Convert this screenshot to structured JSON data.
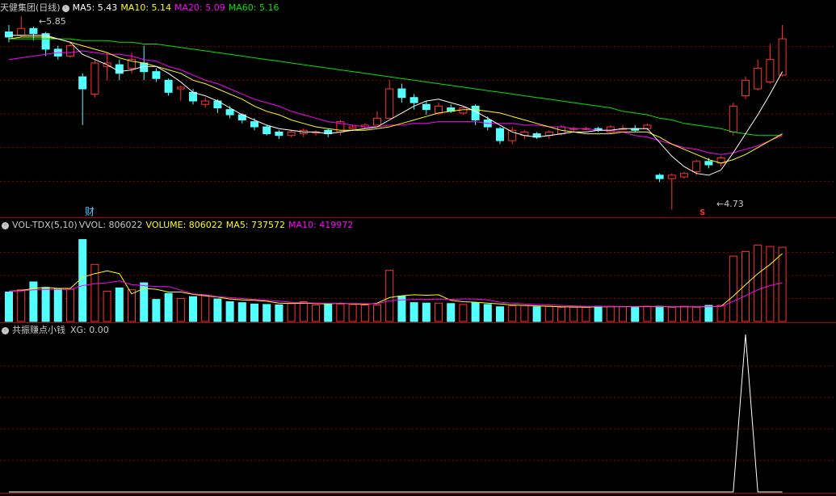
{
  "main": {
    "title": "天健集团(日线)",
    "ma5_label": "MA5: 5.43",
    "ma10_label": "MA10: 5.14",
    "ma20_label": "MA20: 5.09",
    "ma60_label": "MA60: 5.16",
    "high_label": "5.85",
    "low_label": "4.73",
    "cai_marker": "财",
    "s_marker": "S"
  },
  "vol": {
    "title": "VOL-TDX(5,10)",
    "vvol_label": "VVOL: 806022",
    "volume_label": "VOLUME: 806022",
    "ma5_label": "MA5: 737572",
    "ma10_label": "MA10: 419972"
  },
  "ind": {
    "title": "共振赚点小钱",
    "xg_label": "XG: 0.00"
  },
  "colors": {
    "up": "#ff3232",
    "down": "#54ffff",
    "ma5": "#ffffff",
    "ma10": "#ffff00",
    "ma20": "#ff00ff",
    "ma60": "#00e600",
    "grid": "#8a0000",
    "border": "#b40000"
  },
  "chart_data": {
    "type": "candlestick",
    "ohlc": [
      [
        5.76,
        5.73,
        5.8,
        5.7
      ],
      [
        5.74,
        5.78,
        5.85,
        5.73
      ],
      [
        5.78,
        5.75,
        5.79,
        5.71
      ],
      [
        5.75,
        5.66,
        5.76,
        5.62
      ],
      [
        5.66,
        5.62,
        5.68,
        5.6
      ],
      [
        5.62,
        5.68,
        5.7,
        5.61
      ],
      [
        5.5,
        5.43,
        5.52,
        5.22
      ],
      [
        5.4,
        5.58,
        5.6,
        5.38
      ],
      [
        5.56,
        5.58,
        5.64,
        5.48
      ],
      [
        5.57,
        5.52,
        5.6,
        5.48
      ],
      [
        5.55,
        5.6,
        5.64,
        5.52
      ],
      [
        5.58,
        5.53,
        5.68,
        5.48
      ],
      [
        5.53,
        5.49,
        5.55,
        5.47
      ],
      [
        5.48,
        5.41,
        5.49,
        5.39
      ],
      [
        5.43,
        5.44,
        5.45,
        5.36
      ],
      [
        5.41,
        5.36,
        5.43,
        5.34
      ],
      [
        5.34,
        5.36,
        5.38,
        5.32
      ],
      [
        5.36,
        5.32,
        5.37,
        5.29
      ],
      [
        5.31,
        5.28,
        5.33,
        5.26
      ],
      [
        5.28,
        5.25,
        5.29,
        5.23
      ],
      [
        5.24,
        5.21,
        5.26,
        5.19
      ],
      [
        5.21,
        5.17,
        5.22,
        5.16
      ],
      [
        5.18,
        5.16,
        5.19,
        5.14
      ],
      [
        5.16,
        5.18,
        5.19,
        5.15
      ],
      [
        5.17,
        5.19,
        5.2,
        5.15
      ],
      [
        5.18,
        5.18,
        5.19,
        5.16
      ],
      [
        5.19,
        5.17,
        5.2,
        5.15
      ],
      [
        5.18,
        5.24,
        5.25,
        5.16
      ],
      [
        5.2,
        5.21,
        5.22,
        5.19
      ],
      [
        5.21,
        5.22,
        5.23,
        5.2
      ],
      [
        5.22,
        5.26,
        5.3,
        5.22
      ],
      [
        5.26,
        5.43,
        5.48,
        5.26
      ],
      [
        5.43,
        5.38,
        5.46,
        5.35
      ],
      [
        5.38,
        5.35,
        5.4,
        5.31
      ],
      [
        5.34,
        5.31,
        5.36,
        5.28
      ],
      [
        5.29,
        5.33,
        5.35,
        5.28
      ],
      [
        5.32,
        5.3,
        5.34,
        5.29
      ],
      [
        5.29,
        5.32,
        5.33,
        5.28
      ],
      [
        5.33,
        5.25,
        5.34,
        5.22
      ],
      [
        5.25,
        5.21,
        5.27,
        5.19
      ],
      [
        5.2,
        5.13,
        5.21,
        5.11
      ],
      [
        5.13,
        5.19,
        5.21,
        5.11
      ],
      [
        5.16,
        5.18,
        5.19,
        5.14
      ],
      [
        5.17,
        5.15,
        5.18,
        5.14
      ],
      [
        5.16,
        5.18,
        5.19,
        5.14
      ],
      [
        5.17,
        5.21,
        5.22,
        5.16
      ],
      [
        5.2,
        5.2,
        5.21,
        5.18
      ],
      [
        5.2,
        5.2,
        5.21,
        5.19
      ],
      [
        5.2,
        5.19,
        5.21,
        5.18
      ],
      [
        5.18,
        5.21,
        5.22,
        5.17
      ],
      [
        5.2,
        5.2,
        5.22,
        5.19
      ],
      [
        5.2,
        5.19,
        5.22,
        5.18
      ],
      [
        5.2,
        5.22,
        5.23,
        5.19
      ],
      [
        4.93,
        4.91,
        4.94,
        4.89
      ],
      [
        4.91,
        4.93,
        4.94,
        4.73
      ],
      [
        4.92,
        4.94,
        4.95,
        4.91
      ],
      [
        4.95,
        5.01,
        5.02,
        4.93
      ],
      [
        5.01,
        4.99,
        5.03,
        4.97
      ],
      [
        5.0,
        5.03,
        5.04,
        4.98
      ],
      [
        5.18,
        5.33,
        5.35,
        5.16
      ],
      [
        5.39,
        5.48,
        5.5,
        5.37
      ],
      [
        5.43,
        5.55,
        5.6,
        5.42
      ],
      [
        5.47,
        5.6,
        5.69,
        5.46
      ],
      [
        5.51,
        5.72,
        5.8,
        5.5
      ]
    ],
    "ma5": [
      5.74,
      5.74,
      5.74,
      5.74,
      5.72,
      5.7,
      5.63,
      5.6,
      5.57,
      5.53,
      5.54,
      5.56,
      5.56,
      5.52,
      5.47,
      5.41,
      5.39,
      5.36,
      5.32,
      5.28,
      5.25,
      5.22,
      5.2,
      5.19,
      5.18,
      5.18,
      5.17,
      5.18,
      5.19,
      5.2,
      5.21,
      5.25,
      5.29,
      5.33,
      5.36,
      5.37,
      5.35,
      5.33,
      5.3,
      5.26,
      5.22,
      5.18,
      5.16,
      5.15,
      5.16,
      5.17,
      5.18,
      5.18,
      5.19,
      5.19,
      5.2,
      5.2,
      5.2,
      5.12,
      5.04,
      4.98,
      4.94,
      4.93,
      4.96,
      5.06,
      5.17,
      5.28,
      5.4,
      5.53
    ],
    "ma10": [
      5.72,
      5.73,
      5.73,
      5.73,
      5.72,
      5.7,
      5.68,
      5.66,
      5.64,
      5.61,
      5.59,
      5.58,
      5.56,
      5.54,
      5.52,
      5.48,
      5.46,
      5.43,
      5.4,
      5.37,
      5.33,
      5.3,
      5.28,
      5.25,
      5.23,
      5.21,
      5.2,
      5.19,
      5.19,
      5.19,
      5.2,
      5.21,
      5.23,
      5.25,
      5.27,
      5.29,
      5.3,
      5.31,
      5.31,
      5.3,
      5.29,
      5.27,
      5.25,
      5.23,
      5.21,
      5.19,
      5.18,
      5.17,
      5.17,
      5.17,
      5.18,
      5.18,
      5.18,
      5.15,
      5.11,
      5.08,
      5.05,
      5.02,
      5.0,
      5.02,
      5.05,
      5.09,
      5.13,
      5.17
    ],
    "ma20": [
      5.6,
      5.61,
      5.62,
      5.63,
      5.64,
      5.64,
      5.65,
      5.64,
      5.63,
      5.63,
      5.62,
      5.6,
      5.59,
      5.56,
      5.54,
      5.51,
      5.48,
      5.46,
      5.43,
      5.4,
      5.37,
      5.35,
      5.33,
      5.3,
      5.28,
      5.26,
      5.24,
      5.23,
      5.22,
      5.21,
      5.21,
      5.22,
      5.22,
      5.23,
      5.23,
      5.24,
      5.24,
      5.24,
      5.24,
      5.23,
      5.23,
      5.23,
      5.22,
      5.22,
      5.21,
      5.21,
      5.2,
      5.2,
      5.19,
      5.19,
      5.18,
      5.16,
      5.15,
      5.13,
      5.11,
      5.09,
      5.08,
      5.06,
      5.05,
      5.06,
      5.08,
      5.1,
      5.13,
      5.16
    ],
    "ma60": [
      5.72,
      5.72,
      5.72,
      5.72,
      5.72,
      5.72,
      5.71,
      5.71,
      5.71,
      5.7,
      5.7,
      5.69,
      5.69,
      5.68,
      5.67,
      5.66,
      5.65,
      5.64,
      5.63,
      5.62,
      5.61,
      5.6,
      5.59,
      5.58,
      5.57,
      5.56,
      5.55,
      5.54,
      5.53,
      5.52,
      5.51,
      5.5,
      5.49,
      5.48,
      5.47,
      5.46,
      5.45,
      5.44,
      5.43,
      5.42,
      5.41,
      5.4,
      5.39,
      5.38,
      5.37,
      5.36,
      5.35,
      5.34,
      5.33,
      5.32,
      5.3,
      5.29,
      5.28,
      5.26,
      5.25,
      5.23,
      5.22,
      5.21,
      5.2,
      5.18,
      5.17,
      5.16,
      5.16,
      5.16
    ],
    "volume": [
      320000,
      345000,
      430000,
      370000,
      355000,
      350000,
      890000,
      620000,
      330000,
      365000,
      345000,
      420000,
      240000,
      305000,
      250000,
      270000,
      280000,
      245000,
      215000,
      205000,
      190000,
      185000,
      180000,
      200000,
      215000,
      180000,
      185000,
      190000,
      185000,
      180000,
      180000,
      555000,
      275000,
      205000,
      200000,
      200000,
      195000,
      185000,
      205000,
      185000,
      160000,
      170000,
      175000,
      160000,
      165000,
      155000,
      155000,
      155000,
      165000,
      165000,
      160000,
      160000,
      165000,
      165000,
      155000,
      165000,
      155000,
      175000,
      175000,
      710000,
      760000,
      830000,
      815000,
      806022
    ],
    "vol_ma5": [
      330000,
      335000,
      360000,
      370000,
      360000,
      360000,
      480000,
      520000,
      550000,
      520000,
      300000,
      360000,
      350000,
      320000,
      320000,
      295000,
      280000,
      265000,
      245000,
      235000,
      230000,
      220000,
      200000,
      195000,
      200000,
      195000,
      190000,
      200000,
      190000,
      185000,
      200000,
      260000,
      280000,
      290000,
      285000,
      290000,
      230000,
      215000,
      210000,
      200000,
      190000,
      180000,
      175000,
      170000,
      165000,
      160000,
      158000,
      156000,
      160000,
      160000,
      162000,
      162000,
      163000,
      163000,
      160000,
      160000,
      160000,
      160000,
      165000,
      275000,
      400000,
      520000,
      620000,
      737572
    ],
    "vol_ma10": [
      330000,
      332000,
      345000,
      350000,
      348000,
      350000,
      390000,
      410000,
      420000,
      440000,
      400000,
      390000,
      380000,
      380000,
      340000,
      300000,
      290000,
      270000,
      260000,
      250000,
      240000,
      230000,
      220000,
      210000,
      205000,
      200000,
      197000,
      195000,
      195000,
      193000,
      193000,
      225000,
      235000,
      240000,
      240000,
      245000,
      240000,
      245000,
      245000,
      235000,
      210000,
      200000,
      190000,
      185000,
      180000,
      175000,
      170000,
      165000,
      163000,
      162000,
      160000,
      160000,
      160000,
      160000,
      160000,
      160000,
      160000,
      160000,
      162000,
      218000,
      280000,
      345000,
      390000,
      419972
    ],
    "xg": [
      0,
      0,
      0,
      0,
      0,
      0,
      0,
      0,
      0,
      0,
      0,
      0,
      0,
      0,
      0,
      0,
      0,
      0,
      0,
      0,
      0,
      0,
      0,
      0,
      0,
      0,
      0,
      0,
      0,
      0,
      0,
      0,
      0,
      0,
      0,
      0,
      0,
      0,
      0,
      0,
      0,
      0,
      0,
      0,
      0,
      0,
      0,
      0,
      0,
      0,
      0,
      0,
      0,
      0,
      0,
      0,
      0,
      0,
      0,
      0,
      1,
      0,
      0,
      0
    ],
    "price_range": [
      4.7,
      5.87
    ],
    "volume_range": [
      0,
      1000000
    ]
  }
}
